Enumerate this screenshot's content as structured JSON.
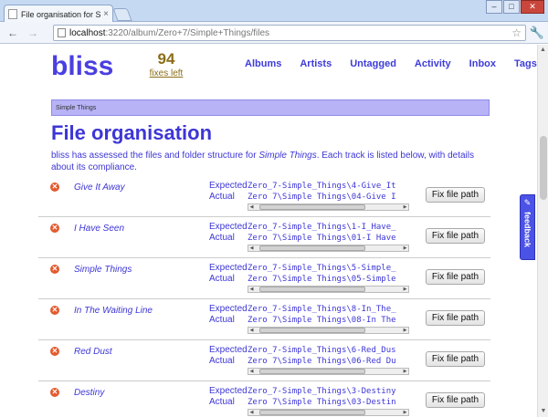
{
  "browser": {
    "tab_title": "File organisation for Simpl",
    "tab_close": "×",
    "back": "←",
    "forward": "→",
    "url_host": "localhost",
    "url_path": ":3220/album/Zero+7/Simple+Things/files",
    "window_buttons": {
      "minimize": "–",
      "maximize": "□",
      "close": "✕"
    }
  },
  "header": {
    "logo": "bliss",
    "fixes_count": "94",
    "fixes_label": "fixes left",
    "nav": [
      "Albums",
      "Artists",
      "Untagged",
      "Activity",
      "Inbox",
      "Tags"
    ]
  },
  "breadcrumb": "Simple Things",
  "page_title": "File organisation",
  "intro": {
    "before": "bliss has assessed the files and folder structure for ",
    "album": "Simple Things",
    "after": ". Each track is listed below, with details about its compliance."
  },
  "labels": {
    "expected": "Expected",
    "actual": "Actual",
    "fix_button": "Fix file path"
  },
  "tracks": [
    {
      "name": "Give It Away",
      "expected": "Zero_7-Simple_Things\\4-Give_It",
      "actual": "Zero 7\\Simple Things\\04-Give I"
    },
    {
      "name": "I Have Seen",
      "expected": "Zero_7-Simple_Things\\1-I_Have_",
      "actual": "Zero 7\\Simple Things\\01-I Have"
    },
    {
      "name": "Simple Things",
      "expected": "Zero_7-Simple_Things\\5-Simple_",
      "actual": "Zero 7\\Simple Things\\05-Simple"
    },
    {
      "name": "In The Waiting Line",
      "expected": "Zero_7-Simple_Things\\8-In_The_",
      "actual": "Zero 7\\Simple Things\\08-In The"
    },
    {
      "name": "Red Dust",
      "expected": "Zero_7-Simple_Things\\6-Red_Dus",
      "actual": "Zero 7\\Simple Things\\06-Red Du"
    },
    {
      "name": "Destiny",
      "expected": "Zero_7-Simple_Things\\3-Destiny",
      "actual": "Zero 7\\Simple Things\\03-Destin"
    }
  ],
  "feedback": "feedback",
  "colors": {
    "accent": "#3d36d6",
    "breadcrumb_bg": "#b7b3f6",
    "error": "#e25a2e",
    "fixes": "#8a6d15"
  }
}
